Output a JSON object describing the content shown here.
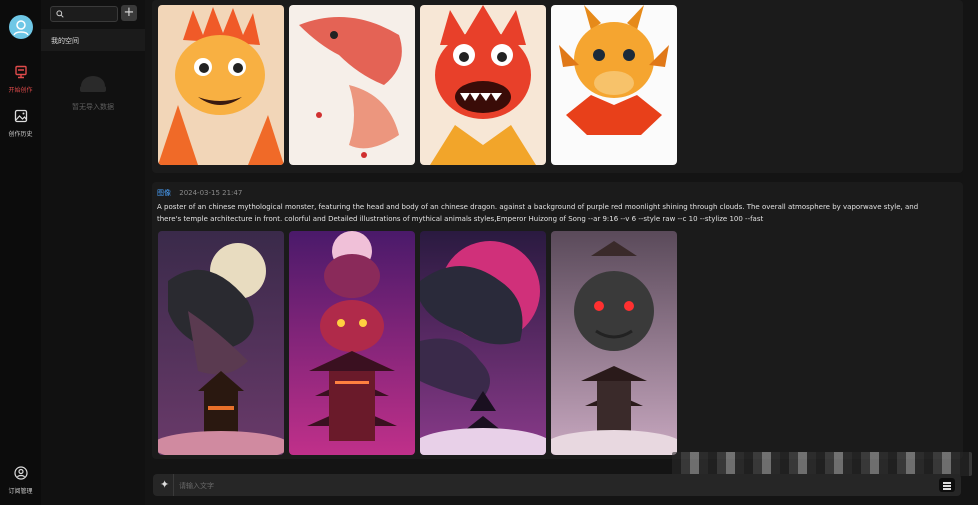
{
  "rail": {
    "items": [
      {
        "label": "开始创作"
      },
      {
        "label": "创作历史"
      },
      {
        "label": "订阅管理"
      }
    ]
  },
  "sidebar": {
    "search_placeholder": "",
    "add_label": "+",
    "space_label": "我的空间",
    "empty_label": "暂无导入数据"
  },
  "messages": [
    {
      "tag": "",
      "timestamp": "",
      "prompt": "",
      "images": [
        "orange-dragon-portrait",
        "red-ink-dragon",
        "red-cartoon-dragon",
        "orange-baby-dragon"
      ]
    },
    {
      "tag": "图像",
      "timestamp": "2024-03-15 21:47",
      "prompt": "A poster of an chinese mythological monster, featuring the head and body of an chinese dragon. against a background of purple red moonlight shining through clouds. The overall atmosphere by vaporwave style, and there's temple architecture in front. colorful and Detailed illustrations of mythical animals styles,Emperor Huizong of Song --ar 9:16 --v 6 --style raw --c 10 --stylize 100 --fast",
      "images": [
        "dragon-moon-temple",
        "dragon-pagoda-purple",
        "dragon-red-moon",
        "dragon-grey-temple"
      ]
    }
  ],
  "composer": {
    "placeholder": "请输入文字"
  }
}
